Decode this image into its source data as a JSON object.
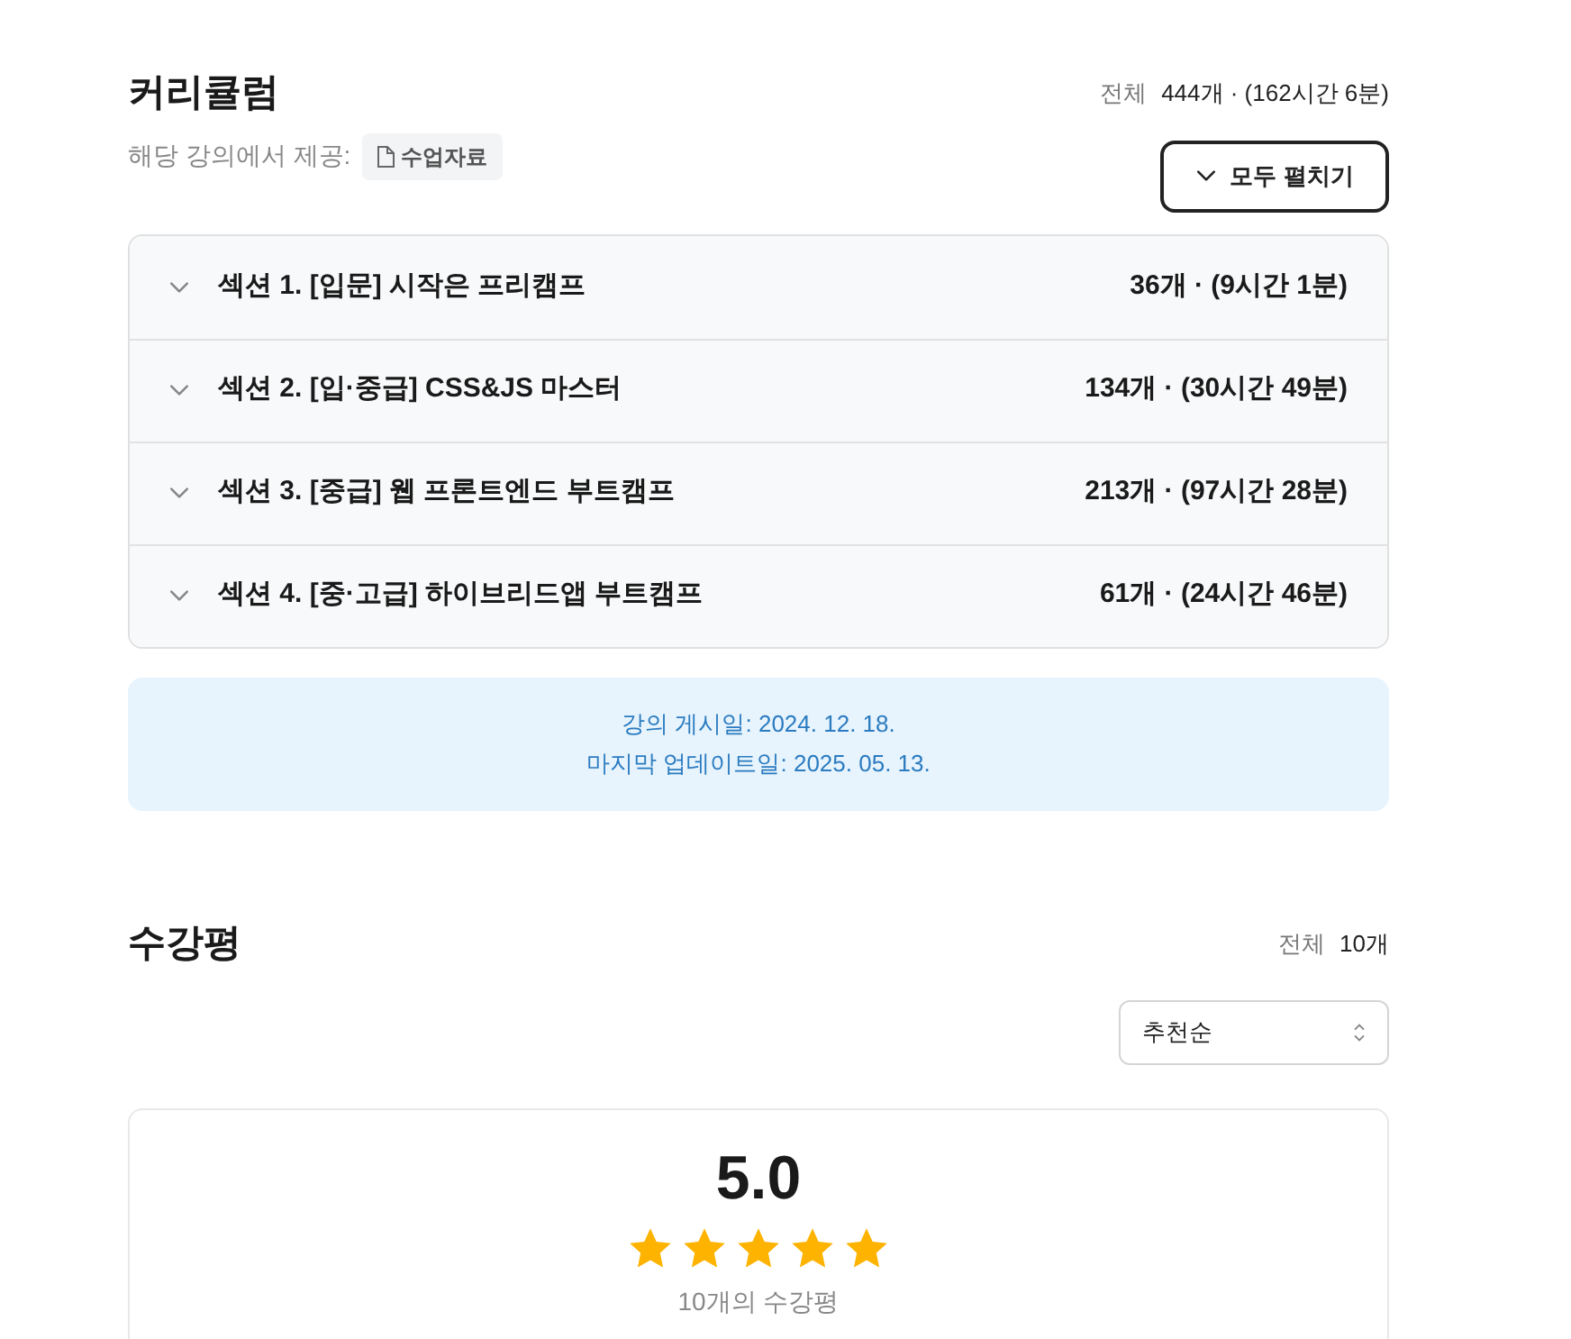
{
  "curriculum": {
    "title": "커리큘럼",
    "total_label": "전체",
    "total_value": "444개 · (162시간 6분)",
    "provided_label": "해당 강의에서 제공:",
    "material_tag": "수업자료",
    "expand_all_button": "모두 펼치기",
    "sections": [
      {
        "title": "섹션 1. [입문] 시작은 프리캠프",
        "summary": "36개 · (9시간 1분)",
        "expanded": false
      },
      {
        "title": "섹션 2. [입·중급] CSS&JS 마스터",
        "summary": "134개 · (30시간 49분)",
        "expanded": false
      },
      {
        "title": "섹션 3. [중급] 웹 프론트엔드 부트캠프",
        "summary": "213개 · (97시간 28분)",
        "expanded": false
      },
      {
        "title": "섹션 4. [중·고급] 하이브리드앱 부트캠프",
        "summary": "61개 · (24시간 46분)",
        "expanded": false
      }
    ],
    "dates": [
      "강의 게시일: 2024. 12. 18.",
      "마지막 업데이트일: 2025. 05. 13."
    ]
  },
  "reviews": {
    "title": "수강평",
    "total_label": "전체",
    "total_value": "10개",
    "sort": {
      "value": "추천순"
    },
    "score": "5.0",
    "stars": 5,
    "count_text": "10개의 수강평"
  }
}
